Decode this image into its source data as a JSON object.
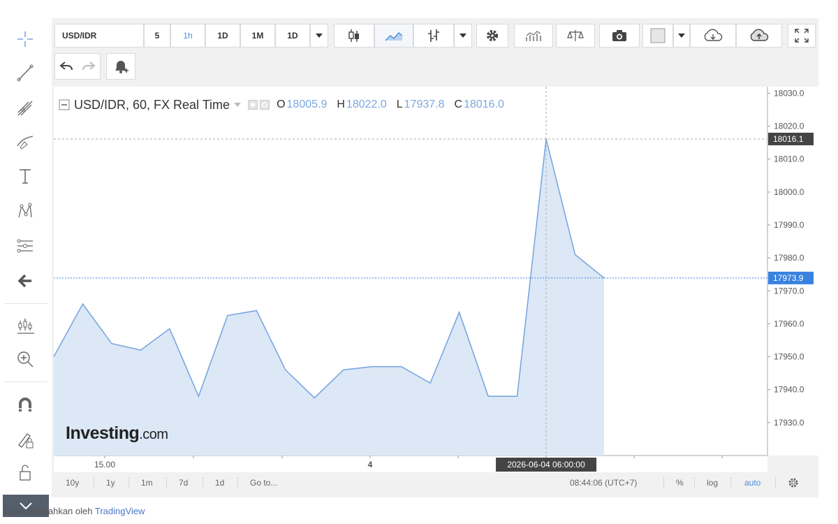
{
  "toolbar": {
    "symbol": "USD/IDR",
    "intervals": [
      "5",
      "1h",
      "1D",
      "1M",
      "1D"
    ],
    "active_interval": "1h"
  },
  "legend": {
    "title": "USD/IDR, 60, FX Real Time",
    "o_label": "O",
    "o": "18005.9",
    "h_label": "H",
    "h": "18022.0",
    "l_label": "L",
    "l": "17937.8",
    "c_label": "C",
    "c": "18016.0"
  },
  "watermark": {
    "brand": "Investing",
    "suffix": ".com"
  },
  "bottom_bar": {
    "ranges": [
      "10y",
      "1y",
      "1m",
      "7d",
      "1d"
    ],
    "goto": "Go to...",
    "time": "08:44:06 (UTC+7)",
    "percent": "%",
    "log": "log",
    "auto": "auto"
  },
  "footer": {
    "prefix": "Dipersembahkan oleh",
    "link": "TradingView"
  },
  "colors": {
    "line": "#7aa7e0",
    "area_fill": "#dce8f6",
    "last_price_badge": "#3a82e0",
    "crosshair_badge": "#444444"
  },
  "chart_data": {
    "type": "area",
    "title": "USD/IDR, 60, FX Real Time",
    "values": [
      17950.0,
      17966.0,
      17954.0,
      17952.0,
      17958.5,
      17938.0,
      17962.5,
      17964.0,
      17946.0,
      17937.5,
      17946.0,
      17947.0,
      17947.0,
      17942.0,
      17963.5,
      17938.0,
      17938.0,
      18016.1,
      17981.0,
      17973.9
    ],
    "x_tick_labels": [
      "15.00",
      "4"
    ],
    "ylim": [
      17920,
      18032
    ],
    "y_ticks": [
      "17930.0",
      "17940.0",
      "17950.0",
      "17960.0",
      "17970.0",
      "17980.0",
      "17990.0",
      "18000.0",
      "18010.0",
      "18020.0",
      "18030.0"
    ],
    "last_price": "17973.9",
    "crosshair_price": "18016.1",
    "crosshair_time": "2026-06-04 06:00:00",
    "grid": false,
    "legend": "top-left"
  }
}
